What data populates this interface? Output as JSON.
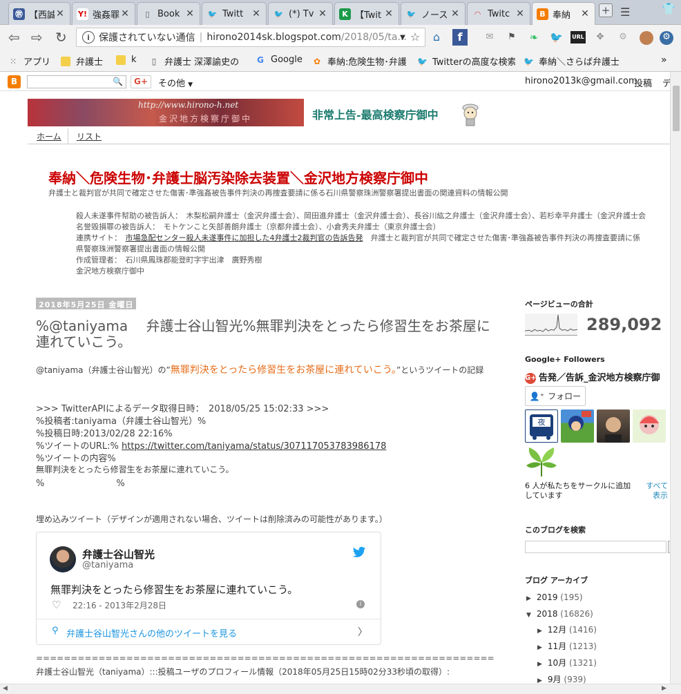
{
  "tabs": [
    {
      "label": "【西誠",
      "icon": "ikura-icon",
      "color": "#3b5998",
      "glyph": "㊪"
    },
    {
      "label": "強姦罪",
      "icon": "yahoo-icon",
      "color": "#ffffff",
      "glyph": "Y!"
    },
    {
      "label": "Book",
      "icon": "page-icon",
      "color": "#ffffff",
      "glyph": "▯"
    },
    {
      "label": "Twitt",
      "icon": "twitter-icon",
      "color": "#1da1f2",
      "glyph": "🐦"
    },
    {
      "label": "(*) Tv",
      "icon": "twitter-icon",
      "color": "#1da1f2",
      "glyph": "🐦"
    },
    {
      "label": "【Twit",
      "icon": "k-icon",
      "color": "#1a9a4a",
      "glyph": "K"
    },
    {
      "label": "ノース",
      "icon": "twitter-icon",
      "color": "#1da1f2",
      "glyph": "🐦"
    },
    {
      "label": "Twitc",
      "icon": "rainbow-icon",
      "color": "#e8453c",
      "glyph": "◠"
    },
    {
      "label": "奉納",
      "icon": "blogger-icon",
      "color": "#f57d00",
      "glyph": "B"
    }
  ],
  "toolbar": {
    "insecure": "保護されていない通信",
    "url_host": "hirono2014sk.blogspot.com",
    "url_path": "/2018/05/ta..."
  },
  "bookmarks": [
    {
      "label": "アプリ",
      "icon": "apps-icon"
    },
    {
      "label": "弁護士",
      "icon": "folder-icon"
    },
    {
      "label": "k",
      "icon": "folder-icon"
    },
    {
      "label": "弁護士 深澤諭史の",
      "icon": "page-icon"
    },
    {
      "label": "Google",
      "icon": "google-icon"
    },
    {
      "label": "奉納:危険生物･弁護",
      "icon": "blogger-icon"
    },
    {
      "label": "Twitterの高度な検索",
      "icon": "twitter-icon"
    },
    {
      "label": "奉納＼さらば弁護士",
      "icon": "twitter-icon"
    }
  ],
  "navbar": {
    "more": "その他",
    "email": "hirono2013k@gmail.com",
    "post": "投稿",
    "design": "デ"
  },
  "banner": {
    "url_text": "http://www.hirono-h.net",
    "sub_text": "金沢地方検察庁御中",
    "title": "非常上告-最高検察庁御中"
  },
  "page_tabs": [
    "ホーム",
    "リスト"
  ],
  "blog": {
    "title": "奉納＼危険生物･弁護士脳汚染除去装置＼金沢地方検察庁御中",
    "description": "弁護士と裁判官が共同で確定させた傷害･準強姦被告事件判決の再捜査要請に係る石川県警察珠洲警察署提出書面の関連資料の情報公開",
    "info_lines": [
      "殺人未遂事件幇助の被告訴人：　木梨松嗣弁護士（金沢弁護士会）、岡田進弁護士（金沢弁護士会）、長谷川紘之弁護士（金沢弁護士会）、若杉幸平弁護士（金沢弁護士会",
      "名誉毀損罪の被告訴人：　モトケンこと矢部善朗弁護士（京都弁護士会）、小倉秀夫弁護士（東京弁護士会）",
      "連携サイト：",
      "県警察珠洲警察署提出書面の情報公開",
      "作成管理者：　石川県鳳珠郡能登町字宇出津　廣野秀樹",
      "金沢地方検察庁御中"
    ],
    "link_text": "市場急配センター殺人未遂事件に加担した4弁護士2裁判官の告訴告発",
    "link_after": "　弁護士と裁判官が共同で確定させた傷害･準強姦被告事件判決の再捜査要請に係"
  },
  "post": {
    "date": "2018年5月25日 金曜日",
    "title": "%@taniyama　 弁護士谷山智光%無罪判決をとったら修習生をお茶屋に連れていこう。",
    "intro_pre": "@taniyama（弁護士谷山智光）の”",
    "intro_quote": "無罪判決をとったら修習生をお茶屋に連れていこう。",
    "intro_post": "”というツイートの記",
    "intro_wrap": "録",
    "api_line": ">>> TwitterAPIによるデータ取得日時：　2018/05/25 15:02:33 >>>",
    "poster": "%投稿者:taniyama（弁護士谷山智光）%",
    "posted_at": "%投稿日時:2013/02/28 22:16%",
    "url_label": "%ツイートのURL:%",
    "url": "https://twitter.com/taniyama/status/307117053783986178",
    "content_label": "%ツイートの内容%",
    "content": "無罪判決をとったら修習生をお茶屋に連れていこう。",
    "content_end": "%　　　　　　　　%",
    "embed_note": "埋め込みツイート（デザインが適用されない場合、ツイートは削除済みの可能性があります。）",
    "divider": "==================================================================",
    "profile_line": "弁護士谷山智光（taniyama）:::投稿ユーザのプロフィール情報（2018年05月25日15時02分33秒頃の取得）:"
  },
  "tweet": {
    "name": "弁護士谷山智光",
    "handle": "@taniyama",
    "text": "無罪判決をとったら修習生をお茶屋に連れていこう。",
    "time": "22:16 - 2013年2月28日",
    "more": "弁護士谷山智光さんの他のツイートを見る"
  },
  "sidebar": {
    "pageviews_title": "ページビューの合計",
    "pageviews": "289,092",
    "followers_title": "Google+ Followers",
    "followers_name": "告発／告訴_金沢地方検察庁御",
    "follow_label": "フォロー",
    "circle_text": "6 人が私たちをサークルに追加しています",
    "see_all": "すべて表示",
    "search_title": "このブログを検索",
    "archive_title": "ブログ アーカイブ",
    "archive": [
      {
        "label": "2019",
        "count": "(195)",
        "expanded": false
      },
      {
        "label": "2018",
        "count": "(16826)",
        "expanded": true
      },
      {
        "label": "12月",
        "count": "(1416)",
        "expanded": false
      },
      {
        "label": "11月",
        "count": "(1213)",
        "expanded": false
      },
      {
        "label": "10月",
        "count": "(1321)",
        "expanded": false
      },
      {
        "label": "9月",
        "count": "(939)",
        "expanded": false
      }
    ]
  }
}
